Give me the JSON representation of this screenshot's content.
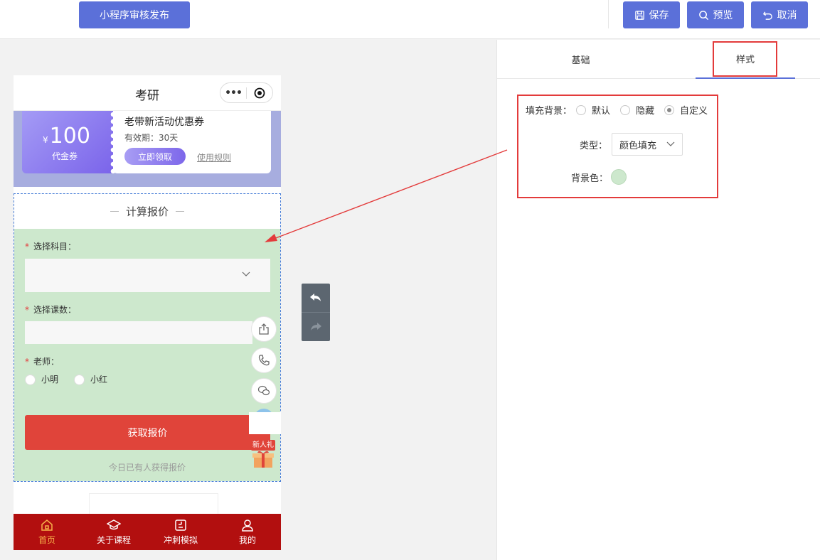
{
  "topbar": {
    "publish_label": "小程序审核发布",
    "save_label": "保存",
    "preview_label": "预览",
    "cancel_label": "取消"
  },
  "colors": {
    "primary": "#5b70d9",
    "highlight_red": "#e33b3b",
    "section_bg": "#cde8cd",
    "tabbar_bg": "#b20f0f",
    "coupon_band": "#a7addf"
  },
  "phone": {
    "title": "考研",
    "capsule": {
      "more": "•••",
      "close_icon": "target-icon"
    },
    "coupon": {
      "currency": "¥",
      "amount": "100",
      "type": "代金券",
      "name": "老带新活动优惠券",
      "validity": "有效期：30天",
      "claim_label": "立即领取",
      "rules_label": "使用规则"
    },
    "form": {
      "title": "计算报价",
      "subject_label": "选择科目：",
      "count_label": "选择课数：",
      "teacher_label": "老师：",
      "teachers": [
        "小明",
        "小红"
      ],
      "submit_label": "获取报价",
      "hint": "今日已有人获得报价",
      "new_gift": "新人礼"
    },
    "tabbar": [
      {
        "label": "首页",
        "icon": "home-icon",
        "active": true
      },
      {
        "label": "关于课程",
        "icon": "graduation-cap-icon",
        "active": false
      },
      {
        "label": "冲刺模拟",
        "icon": "quiz-icon",
        "active": false
      },
      {
        "label": "我的",
        "icon": "user-icon",
        "active": false
      }
    ]
  },
  "panel": {
    "tabs": [
      "基础",
      "样式"
    ],
    "active_tab": "样式",
    "fill_label": "填充背景：",
    "fill_options": [
      "默认",
      "隐藏",
      "自定义"
    ],
    "fill_selected": "自定义",
    "type_label": "类型：",
    "type_value": "颜色填充",
    "bgcolor_label": "背景色：",
    "bgcolor_value": "#cde8cd"
  }
}
